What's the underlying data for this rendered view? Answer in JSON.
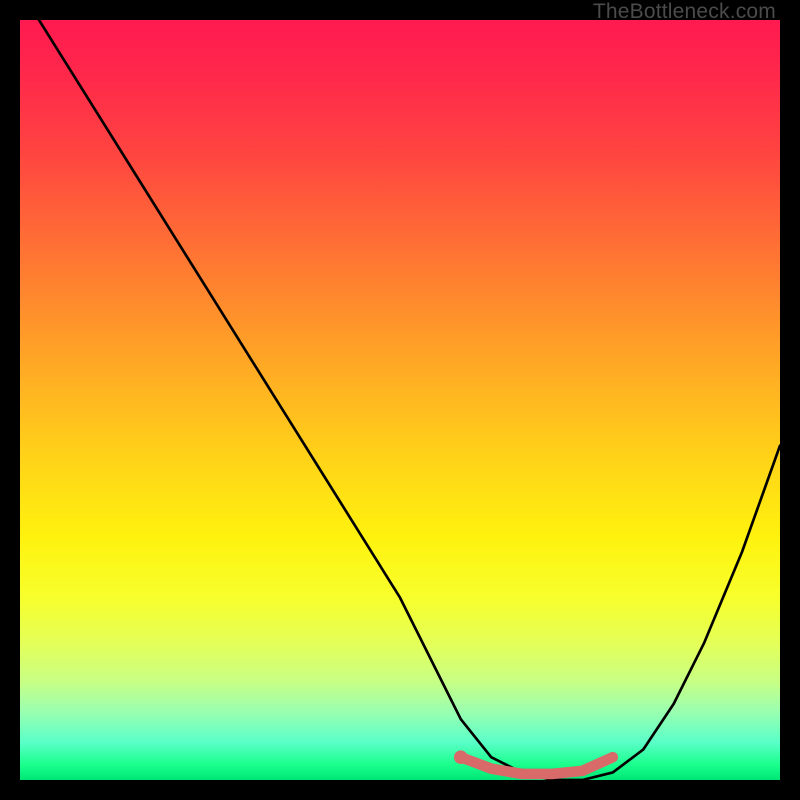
{
  "watermark": "TheBottleneck.com",
  "chart_data": {
    "type": "line",
    "title": "",
    "xlabel": "",
    "ylabel": "",
    "xlim": [
      0,
      100
    ],
    "ylim": [
      0,
      100
    ],
    "series": [
      {
        "name": "bottleneck-curve",
        "x": [
          0,
          5,
          10,
          15,
          20,
          25,
          30,
          35,
          40,
          45,
          50,
          55,
          58,
          62,
          66,
          70,
          74,
          78,
          82,
          86,
          90,
          95,
          100
        ],
        "values": [
          104,
          96,
          88,
          80,
          72,
          64,
          56,
          48,
          40,
          32,
          24,
          14,
          8,
          3,
          1,
          0,
          0,
          1,
          4,
          10,
          18,
          30,
          44
        ]
      },
      {
        "name": "optimal-range-marker",
        "x": [
          58,
          62,
          66,
          70,
          74,
          78
        ],
        "values": [
          3,
          1.5,
          0.8,
          0.8,
          1.2,
          3
        ]
      }
    ],
    "annotations": []
  },
  "colors": {
    "curve": "#000000",
    "marker": "#d86a6a",
    "marker_dot": "#d86a6a"
  }
}
